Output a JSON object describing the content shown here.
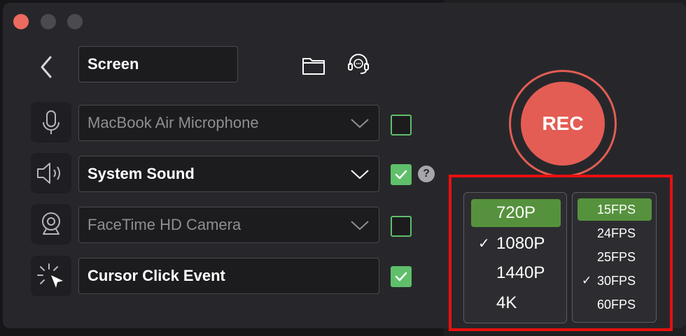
{
  "window": {
    "name_field": "Screen",
    "icons": {
      "back": "chevron-left-icon",
      "folder": "folder-icon",
      "support": "headset-icon"
    }
  },
  "sources": [
    {
      "id": "microphone",
      "icon": "microphone-icon",
      "label": "MacBook Air Microphone",
      "enabled": false,
      "checked": false
    },
    {
      "id": "system-sound",
      "icon": "speaker-icon",
      "label": "System Sound",
      "enabled": true,
      "checked": true,
      "help": "?"
    },
    {
      "id": "camera",
      "icon": "webcam-icon",
      "label": "FaceTime HD Camera",
      "enabled": false,
      "checked": false
    },
    {
      "id": "cursor",
      "icon": "cursor-click-icon",
      "label": "Cursor Click Event",
      "enabled": true,
      "checked": true
    }
  ],
  "record": {
    "label": "REC"
  },
  "resolution_menu": {
    "items": [
      {
        "label": "720P",
        "highlighted": true,
        "checked": false
      },
      {
        "label": "1080P",
        "highlighted": false,
        "checked": true
      },
      {
        "label": "1440P",
        "highlighted": false,
        "checked": false
      },
      {
        "label": "4K",
        "highlighted": false,
        "checked": false
      }
    ]
  },
  "fps_menu": {
    "items": [
      {
        "label": "15FPS",
        "highlighted": true,
        "checked": false
      },
      {
        "label": "24FPS",
        "highlighted": false,
        "checked": false
      },
      {
        "label": "25FPS",
        "highlighted": false,
        "checked": false
      },
      {
        "label": "30FPS",
        "highlighted": false,
        "checked": true
      },
      {
        "label": "60FPS",
        "highlighted": false,
        "checked": false
      }
    ]
  },
  "colors": {
    "accent_green": "#5fbf6a",
    "menu_highlight": "#56923d",
    "record_red": "#e35d54",
    "annotation_red": "#e81010"
  }
}
